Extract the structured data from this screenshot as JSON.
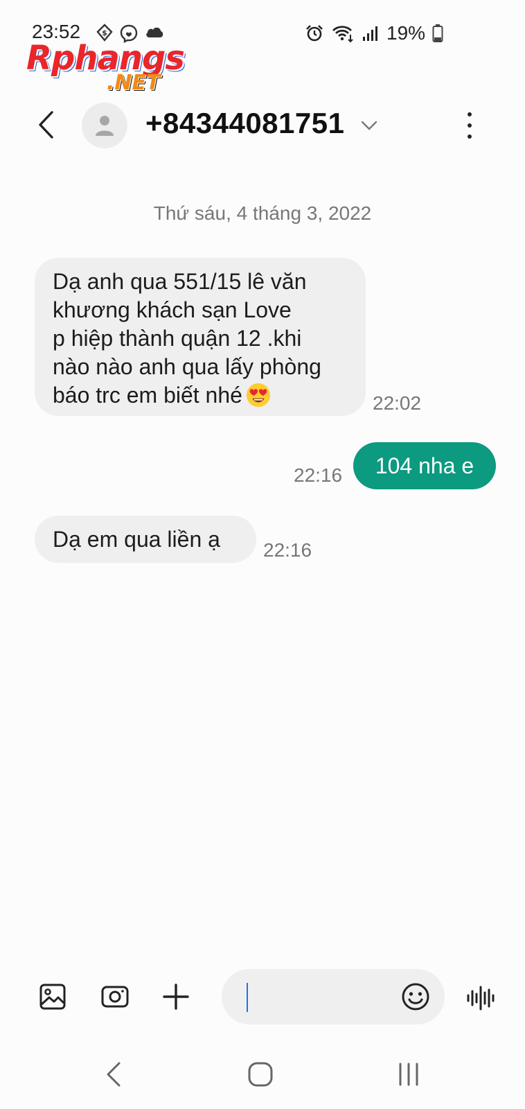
{
  "status_bar": {
    "time": "23:52",
    "battery": "19%",
    "left_icons": [
      "crypto-icon",
      "messenger-icon",
      "cloud-icon"
    ],
    "right_icons": [
      "alarm-icon",
      "wifi-icon",
      "signal-icon",
      "battery-icon"
    ]
  },
  "watermark": {
    "main": "Rphangs",
    "suffix": ".NET"
  },
  "header": {
    "contact": "+84344081751"
  },
  "conversation": {
    "date": "Thứ sáu, 4 tháng 3, 2022",
    "messages": [
      {
        "direction": "incoming",
        "lines": [
          "Dạ anh qua 551/15 lê văn",
          "khương khách sạn Love",
          "p hiệp thành quận 12 .khi",
          "nào nào anh qua lấy phòng",
          "báo trc em biết nhé"
        ],
        "emoji": "heart-eyes-emoji",
        "time": "22:02"
      },
      {
        "direction": "outgoing",
        "text": "104 nha e",
        "time": "22:16"
      },
      {
        "direction": "incoming",
        "text": "Dạ em qua liền ạ",
        "time": "22:16"
      }
    ]
  },
  "compose": {
    "value": "",
    "placeholder": ""
  },
  "colors": {
    "outgoing_bubble": "#0c9a80",
    "incoming_bubble": "#efefef",
    "background": "#fcfcfc",
    "caret": "#1a73e8"
  }
}
